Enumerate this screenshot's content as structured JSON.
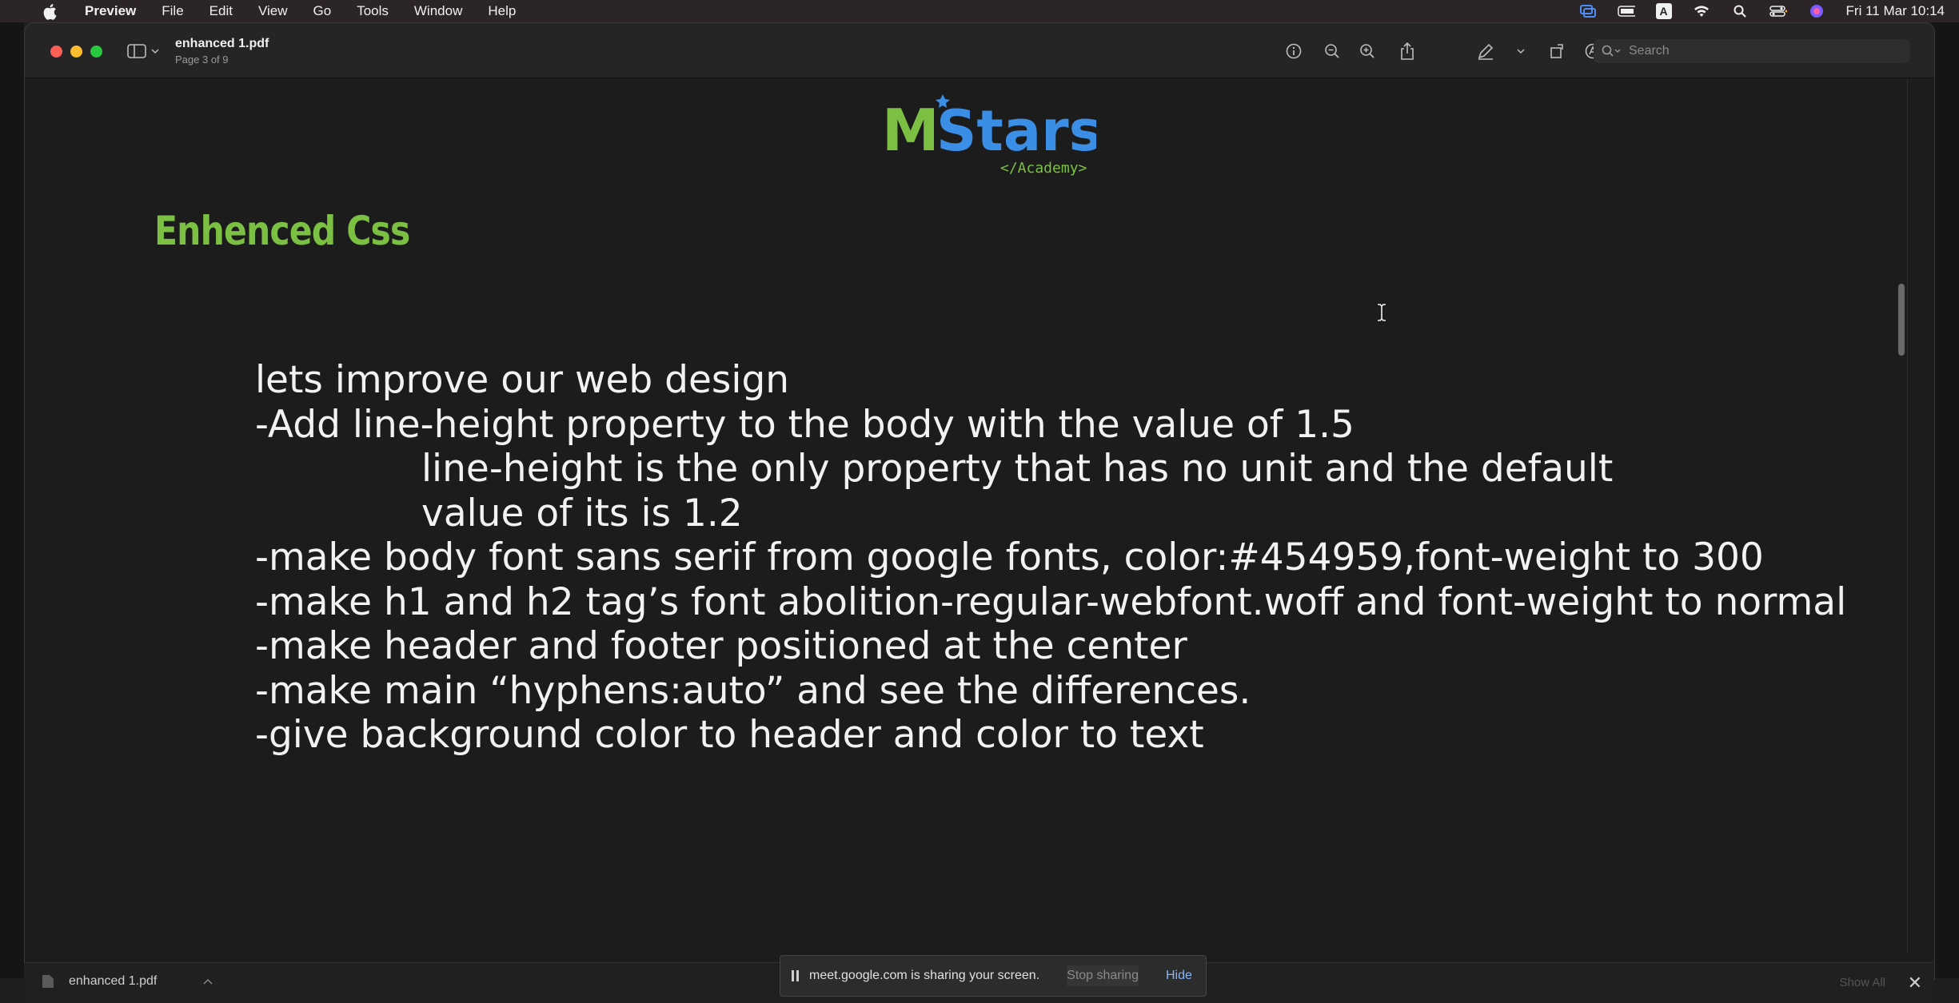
{
  "menubar": {
    "app": "Preview",
    "items": [
      "File",
      "Edit",
      "View",
      "Go",
      "Tools",
      "Window",
      "Help"
    ],
    "status_letter": "A",
    "clock": "Fri 11 Mar  10:14"
  },
  "window": {
    "doc_title": "enhanced 1.pdf",
    "page_indicator": "Page 3 of 9",
    "search_placeholder": "Search"
  },
  "page": {
    "logo_main": "MStars",
    "logo_sub": "</Academy>",
    "heading": "Enhenced Css",
    "lines": [
      "lets improve our web design",
      "-Add line-height property to the body with the value of 1.5",
      "line-height is the only property that has no unit and the default",
      "value of its is 1.2",
      "-make body font sans serif from google fonts, color:#454959,font-weight to 300",
      "-make h1 and h2 tag’s font abolition-regular-webfont.woff and font-weight to normal",
      "-make header and footer positioned at the center",
      "-make main “hyphens:auto” and see the differences.",
      "-give background color to header and color to text"
    ]
  },
  "bottombar": {
    "file_name": "enhanced 1.pdf",
    "show_all": "Show All"
  },
  "share_notice": {
    "message": "meet.google.com is sharing your screen.",
    "stop_label": "Stop sharing",
    "hide_label": "Hide"
  },
  "colors": {
    "heading_green": "#7bc043",
    "logo_green": "#7bc043",
    "logo_blue": "#3a8ee6",
    "link_blue": "#8ab4f8"
  }
}
